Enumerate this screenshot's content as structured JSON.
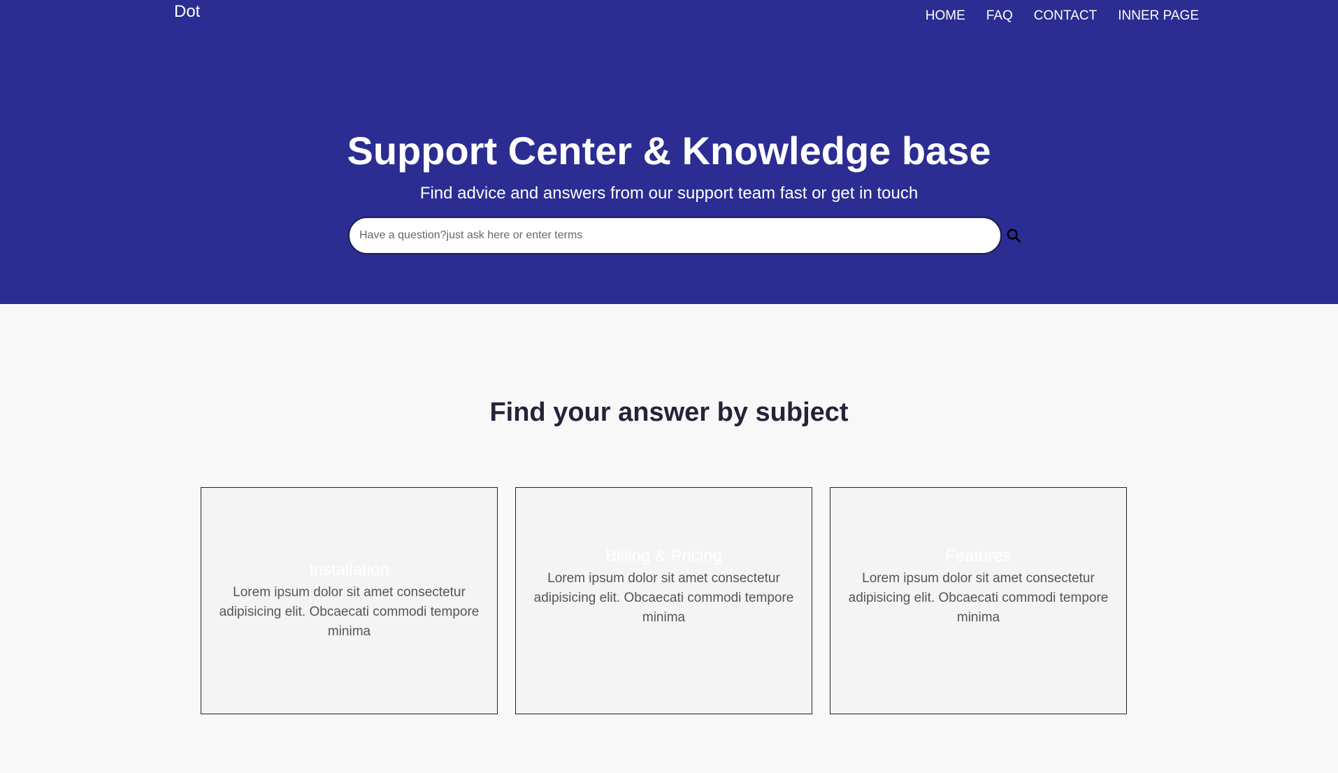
{
  "header": {
    "brand": "Dot",
    "nav": [
      "HOME",
      "FAQ",
      "CONTACT",
      "INNER PAGE"
    ]
  },
  "hero": {
    "title": "Support Center & Knowledge base",
    "subtitle": "Find advice and answers from our support team fast or get in touch",
    "search_placeholder": "Have a question?just ask here or enter terms",
    "search_icon": "search-icon"
  },
  "subjects": {
    "title": "Find your answer by subject",
    "cards": [
      {
        "title": "Installation",
        "text": "Lorem ipsum dolor sit amet consectetur adipisicing elit. Obcaecati commodi tempore minima"
      },
      {
        "title": "Billing & Pricing",
        "text": "Lorem ipsum dolor sit amet consectetur adipisicing elit. Obcaecati commodi tempore minima"
      },
      {
        "title": "Features",
        "text": "Lorem ipsum dolor sit amet consectetur adipisicing elit. Obcaecati commodi tempore minima"
      }
    ]
  },
  "colors": {
    "hero_bg": "#2b2d92",
    "page_bg": "#f8f8f8",
    "heading": "#23233a"
  }
}
